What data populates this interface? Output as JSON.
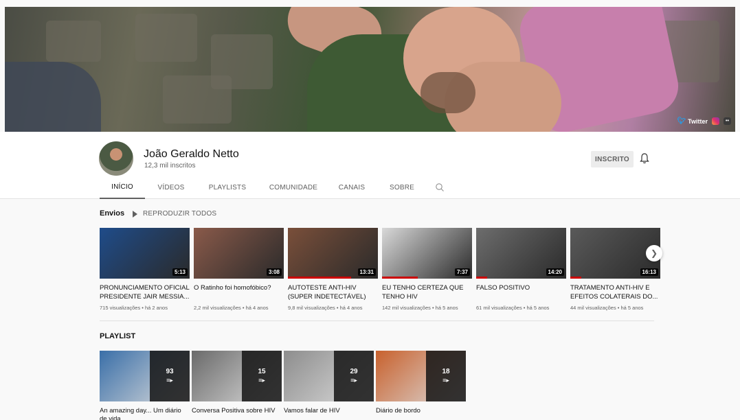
{
  "banner": {
    "social": {
      "twitter_label": "Twitter"
    }
  },
  "channel": {
    "name": "João Geraldo Netto",
    "subscribers": "12,3 mil inscritos",
    "subscribe_label": "INSCRITO"
  },
  "tabs": [
    {
      "label": "INÍCIO",
      "active": true
    },
    {
      "label": "VÍDEOS"
    },
    {
      "label": "PLAYLISTS"
    },
    {
      "label": "COMUNIDADE"
    },
    {
      "label": "CANAIS"
    },
    {
      "label": "SOBRE"
    }
  ],
  "uploads": {
    "title": "Envios",
    "play_all": "REPRODUZIR TODOS",
    "videos": [
      {
        "title": "PRONUNCIAMENTO OFICIAL PRESIDENTE JAIR MESSIA...",
        "meta": "715 visualizações • há 2 anos",
        "duration": "5:13",
        "thumb_color": "#1f4c8a"
      },
      {
        "title": "O Ratinho foi homofóbico?",
        "meta": "2,2 mil visualizações • há 4 anos",
        "duration": "3:08",
        "thumb_color": "#8a5a4a"
      },
      {
        "title": "AUTOTESTE ANTI-HIV (SUPER INDETECTÁVEL)",
        "meta": "9,8 mil visualizações • há 4 anos",
        "duration": "13:31",
        "thumb_color": "#7a4f3a"
      },
      {
        "title": "EU TENHO CERTEZA QUE TENHO HIV",
        "meta": "142 mil visualizações • há 5 anos",
        "duration": "7:37",
        "thumb_color": "#d9d9d9"
      },
      {
        "title": "FALSO POSITIVO",
        "meta": "61 mil visualizações • há 5 anos",
        "duration": "14:20",
        "thumb_color": "#6d6d6d"
      },
      {
        "title": "TRATAMENTO ANTI-HIV E EFEITOS COLATERAIS DO...",
        "meta": "44 mil visualizações • há 5 anos",
        "duration": "16:13",
        "thumb_color": "#5a5a5a"
      }
    ]
  },
  "playlists": {
    "title": "PLAYLIST",
    "items": [
      {
        "title": "An amazing day... Um diário de vida",
        "count": "93",
        "thumb_color": "#3a6fa8"
      },
      {
        "title": "Conversa Positiva sobre HIV",
        "count": "15",
        "thumb_color": "#6a6a6a"
      },
      {
        "title": "Vamos falar de HIV",
        "count": "29",
        "thumb_color": "#8d8d8d"
      },
      {
        "title": "Diário de bordo",
        "count": "18",
        "thumb_color": "#c8612d"
      }
    ]
  }
}
